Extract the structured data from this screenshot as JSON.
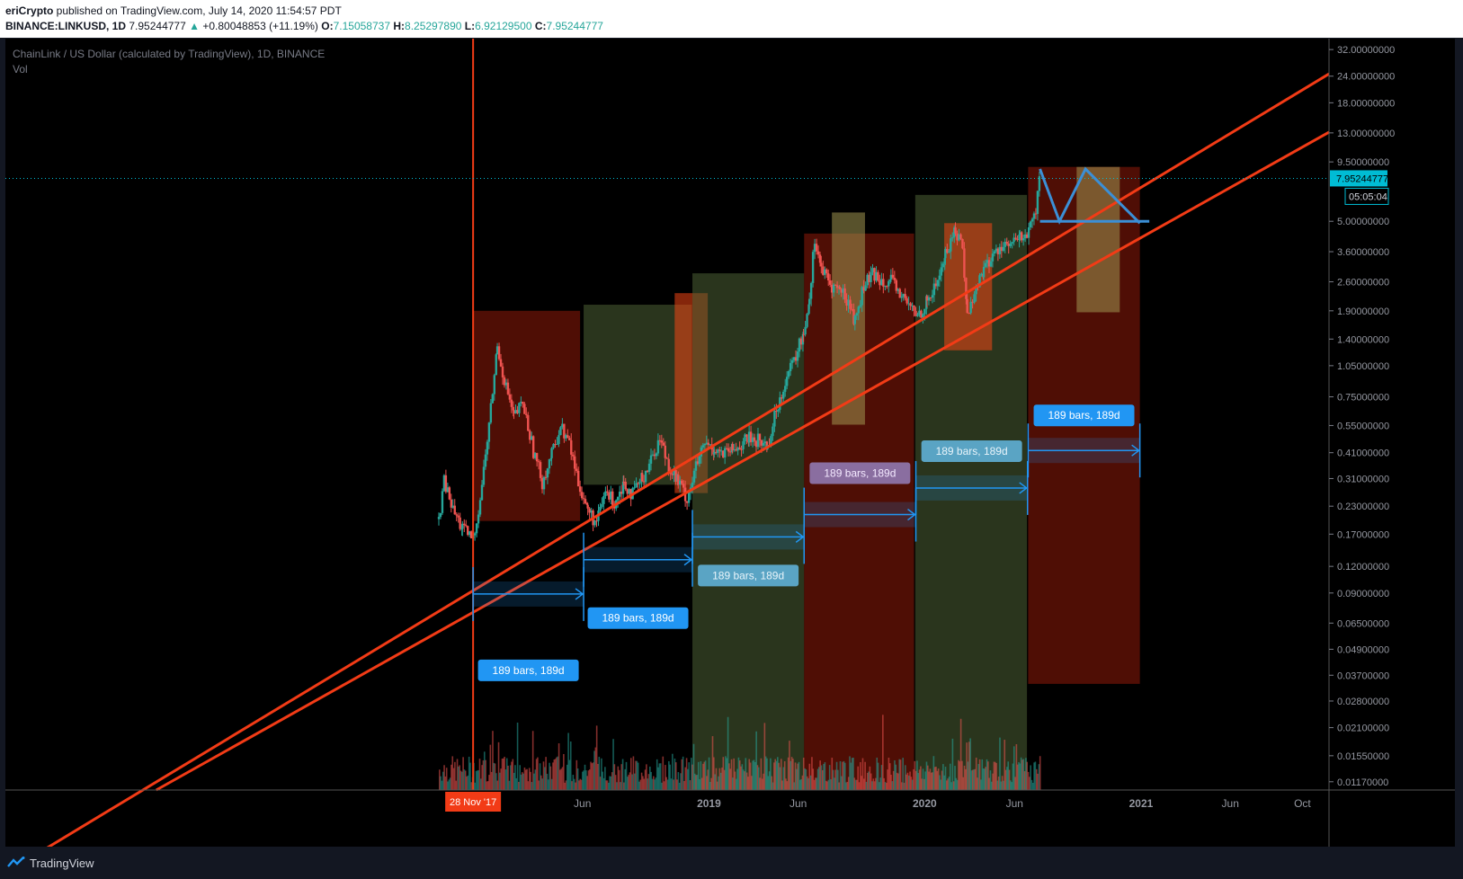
{
  "header": {
    "publisher": "eriCrypto",
    "publish_text": " published on TradingView.com, July 14, 2020 11:54:57 PDT",
    "symbol_line": "BINANCE:LINKUSD, 1D",
    "last": "7.95244777",
    "change": "+0.80048853 (+11.19%)",
    "o_label": "O:",
    "o": "7.15058737",
    "h_label": "H:",
    "h": "8.25297890",
    "l_label": "L:",
    "l": "6.92129500",
    "c_label": "C:",
    "c": "7.95244777"
  },
  "legend": {
    "title": "ChainLink / US Dollar (calculated by TradingView), 1D, BINANCE",
    "vol": "Vol"
  },
  "footer": {
    "brand": "TradingView"
  },
  "colors": {
    "background": "#000000",
    "up": "#26a69a",
    "down": "#ef5350",
    "trendline": "#f23b16",
    "arrow": "#2196f3",
    "last_price_tag": "#00bcd4",
    "date_tag": "#f23b16"
  },
  "chart_data": {
    "type": "candlestick",
    "title": "ChainLink / US Dollar (calculated by TradingView), 1D, BINANCE",
    "y_scale": "log",
    "ylim": [
      0.0107,
      36
    ],
    "y_ticks": [
      "32.00000000",
      "24.00000000",
      "18.00000000",
      "13.00000000",
      "9.50000000",
      "5.00000000",
      "3.60000000",
      "2.60000000",
      "1.90000000",
      "1.40000000",
      "1.05000000",
      "0.75000000",
      "0.55000000",
      "0.41000000",
      "0.31000000",
      "0.23000000",
      "0.17000000",
      "0.12000000",
      "0.09000000",
      "0.06500000",
      "0.04900000",
      "0.03700000",
      "0.02800000",
      "0.02100000",
      "0.01550000",
      "0.01170000"
    ],
    "x_axis_range": [
      "2017-10-01",
      "2021-11-15"
    ],
    "x_ticks": [
      {
        "date": "2018-06-01",
        "label": "Jun"
      },
      {
        "date": "2019-01-01",
        "label": "2019"
      },
      {
        "date": "2019-06-01",
        "label": "Jun"
      },
      {
        "date": "2020-01-01",
        "label": "2020"
      },
      {
        "date": "2020-06-01",
        "label": "Jun"
      },
      {
        "date": "2021-01-01",
        "label": "2021"
      },
      {
        "date": "2021-06-01",
        "label": "Jun"
      },
      {
        "date": "2021-10-01",
        "label": "Oct"
      }
    ],
    "last_price": "7.95244777",
    "countdown": "05:05:04",
    "marker_date": {
      "date": "2017-11-28",
      "label": "28 Nov '17"
    },
    "price_path": [
      [
        "2017-10-01",
        0.2
      ],
      [
        "2017-10-10",
        0.3
      ],
      [
        "2017-10-25",
        0.22
      ],
      [
        "2017-11-10",
        0.18
      ],
      [
        "2017-11-28",
        0.16
      ],
      [
        "2017-12-10",
        0.25
      ],
      [
        "2017-12-25",
        0.55
      ],
      [
        "2018-01-08",
        1.3
      ],
      [
        "2018-01-20",
        0.9
      ],
      [
        "2018-02-05",
        0.6
      ],
      [
        "2018-02-20",
        0.7
      ],
      [
        "2018-03-10",
        0.42
      ],
      [
        "2018-03-25",
        0.3
      ],
      [
        "2018-04-10",
        0.4
      ],
      [
        "2018-04-25",
        0.55
      ],
      [
        "2018-05-10",
        0.45
      ],
      [
        "2018-05-25",
        0.3
      ],
      [
        "2018-06-10",
        0.22
      ],
      [
        "2018-06-25",
        0.19
      ],
      [
        "2018-07-10",
        0.27
      ],
      [
        "2018-07-25",
        0.24
      ],
      [
        "2018-08-10",
        0.3
      ],
      [
        "2018-08-25",
        0.26
      ],
      [
        "2018-09-10",
        0.31
      ],
      [
        "2018-09-25",
        0.38
      ],
      [
        "2018-10-10",
        0.48
      ],
      [
        "2018-10-25",
        0.36
      ],
      [
        "2018-11-10",
        0.3
      ],
      [
        "2018-11-25",
        0.25
      ],
      [
        "2018-12-10",
        0.35
      ],
      [
        "2018-12-25",
        0.45
      ],
      [
        "2019-01-10",
        0.43
      ],
      [
        "2019-01-25",
        0.4
      ],
      [
        "2019-02-10",
        0.42
      ],
      [
        "2019-02-25",
        0.45
      ],
      [
        "2019-03-10",
        0.48
      ],
      [
        "2019-03-25",
        0.47
      ],
      [
        "2019-04-10",
        0.44
      ],
      [
        "2019-04-25",
        0.65
      ],
      [
        "2019-05-10",
        0.9
      ],
      [
        "2019-05-25",
        1.1
      ],
      [
        "2019-06-10",
        1.5
      ],
      [
        "2019-06-20",
        2.2
      ],
      [
        "2019-06-29",
        4.2
      ],
      [
        "2019-07-10",
        3.0
      ],
      [
        "2019-07-25",
        2.5
      ],
      [
        "2019-08-10",
        2.4
      ],
      [
        "2019-08-25",
        2.1
      ],
      [
        "2019-09-05",
        1.7
      ],
      [
        "2019-09-20",
        2.5
      ],
      [
        "2019-10-05",
        2.8
      ],
      [
        "2019-10-20",
        2.7
      ],
      [
        "2019-11-05",
        2.6
      ],
      [
        "2019-11-20",
        2.3
      ],
      [
        "2019-12-05",
        2.0
      ],
      [
        "2019-12-20",
        1.8
      ],
      [
        "2020-01-05",
        2.1
      ],
      [
        "2020-01-20",
        2.5
      ],
      [
        "2020-02-05",
        3.5
      ],
      [
        "2020-02-22",
        4.6
      ],
      [
        "2020-03-05",
        3.8
      ],
      [
        "2020-03-13",
        1.8
      ],
      [
        "2020-03-25",
        2.3
      ],
      [
        "2020-04-10",
        3.0
      ],
      [
        "2020-04-25",
        3.4
      ],
      [
        "2020-05-10",
        3.9
      ],
      [
        "2020-05-25",
        3.8
      ],
      [
        "2020-06-10",
        4.2
      ],
      [
        "2020-06-25",
        4.4
      ],
      [
        "2020-07-07",
        5.6
      ],
      [
        "2020-07-14",
        7.95
      ]
    ],
    "trendlines": [
      {
        "from": [
          "2015-10-01",
          0.0044
        ],
        "to": [
          "2021-11-15",
          24.6
        ]
      },
      {
        "from": [
          "2016-06-10",
          0.0107
        ],
        "to": [
          "2021-11-15",
          13.1
        ]
      }
    ],
    "zones": [
      {
        "color": "red",
        "x0": "2017-11-28",
        "x1": "2018-05-28",
        "y0": 0.196,
        "y1": 1.9
      },
      {
        "color": "green",
        "x0": "2018-06-03",
        "x1": "2018-12-03",
        "y0": 0.29,
        "y1": 2.03
      },
      {
        "color": "orange",
        "x0": "2018-11-04",
        "x1": "2018-12-30",
        "y0": 0.265,
        "y1": 2.3
      },
      {
        "color": "green",
        "x0": "2018-12-04",
        "x1": "2019-06-11",
        "y0": 0.0107,
        "y1": 2.85
      },
      {
        "color": "red",
        "x0": "2019-06-11",
        "x1": "2019-12-14",
        "y0": 0.0107,
        "y1": 4.38
      },
      {
        "color": "olive",
        "x0": "2019-07-28",
        "x1": "2019-09-22",
        "y0": 0.555,
        "y1": 5.5
      },
      {
        "color": "green",
        "x0": "2019-12-16",
        "x1": "2020-06-22",
        "y0": 0.0107,
        "y1": 6.65
      },
      {
        "color": "orange",
        "x0": "2020-02-03",
        "x1": "2020-04-24",
        "y0": 1.24,
        "y1": 4.9
      },
      {
        "color": "red",
        "x0": "2020-06-24",
        "x1": "2020-12-30",
        "y0": 0.0337,
        "y1": 9.0
      },
      {
        "color": "olive",
        "x0": "2020-09-14",
        "x1": "2020-11-26",
        "y0": 1.87,
        "y1": 9.0
      }
    ],
    "date_ranges": [
      {
        "from": "2017-11-28",
        "to": "2018-06-03",
        "price": 0.089,
        "label": "189 bars, 189d"
      },
      {
        "from": "2018-06-03",
        "to": "2018-12-04",
        "price": 0.129,
        "label": "189 bars, 189d"
      },
      {
        "from": "2018-12-04",
        "to": "2019-06-11",
        "price": 0.165,
        "label": "189 bars, 189d"
      },
      {
        "from": "2019-06-11",
        "to": "2019-12-17",
        "price": 0.21,
        "label": "189 bars, 189d"
      },
      {
        "from": "2019-12-17",
        "to": "2020-06-23",
        "price": 0.28,
        "label": "189 bars, 189d"
      },
      {
        "from": "2020-06-24",
        "to": "2020-12-30",
        "price": 0.42,
        "label": "189 bars, 189d"
      }
    ],
    "projection": [
      [
        "2020-07-14",
        8.8
      ],
      [
        "2020-08-16",
        5.0
      ],
      [
        "2020-09-29",
        8.8
      ],
      [
        "2020-12-30",
        4.9
      ]
    ],
    "projection_base": [
      [
        "2020-07-14",
        5.0
      ],
      [
        "2021-01-15",
        5.0
      ]
    ]
  }
}
